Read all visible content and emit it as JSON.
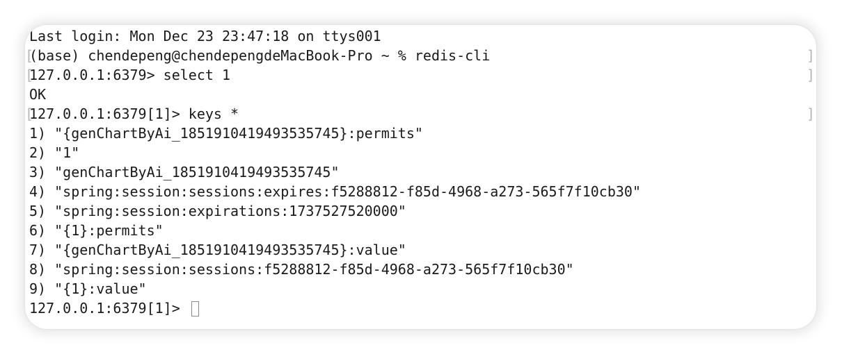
{
  "terminal": {
    "lines": [
      "Last login: Mon Dec 23 23:47:18 on ttys001",
      "(base) chendepeng@chendepengdeMacBook-Pro ~ % redis-cli",
      "127.0.0.1:6379> select 1",
      "OK",
      "127.0.0.1:6379[1]> keys *",
      "1) \"{genChartByAi_1851910419493535745}:permits\"",
      "2) \"1\"",
      "3) \"genChartByAi_1851910419493535745\"",
      "4) \"spring:session:sessions:expires:f5288812-f85d-4968-a273-565f7f10cb30\"",
      "5) \"spring:session:expirations:1737527520000\"",
      "6) \"{1}:permits\"",
      "7) \"{genChartByAi_1851910419493535745}:value\"",
      "8) \"spring:session:sessions:f5288812-f85d-4968-a273-565f7f10cb30\"",
      "9) \"{1}:value\""
    ],
    "prompt": "127.0.0.1:6379[1]> "
  }
}
